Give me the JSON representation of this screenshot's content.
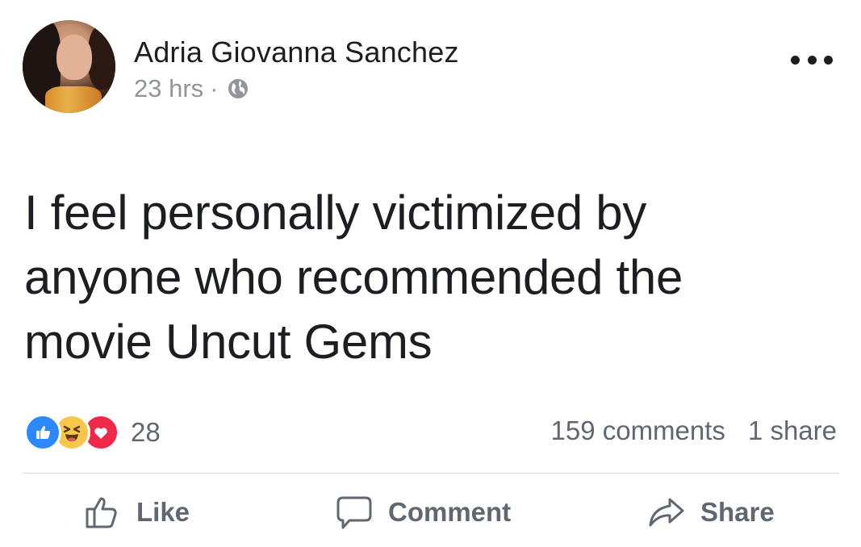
{
  "post": {
    "author_name": "Adria Giovanna Sanchez",
    "timestamp": "23 hrs",
    "separator": "·",
    "privacy_icon": "globe-icon",
    "more_icon": "more-options-icon",
    "text_lines": [
      "I feel personally victimized by",
      "anyone who recommended the",
      "movie Uncut Gems"
    ]
  },
  "engagement": {
    "reaction_types": [
      "like",
      "haha",
      "love"
    ],
    "reaction_count": "28",
    "comments_label": "159 comments",
    "shares_label": "1 share"
  },
  "actions": {
    "like_label": "Like",
    "comment_label": "Comment",
    "share_label": "Share"
  },
  "colors": {
    "text_primary": "#1c1e21",
    "text_secondary": "#606770",
    "meta_gray": "#90949c",
    "like_blue": "#2d88ff",
    "haha_yellow": "#f7c64a",
    "love_red": "#f0284a",
    "divider": "#dadde1"
  }
}
